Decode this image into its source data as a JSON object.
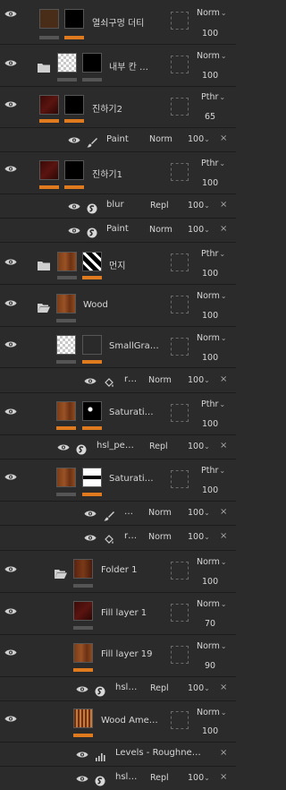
{
  "layers": [
    {
      "id": "l1",
      "name": "열쇠구멍 더티",
      "blend": "Norm",
      "opacity": "100"
    },
    {
      "id": "l2",
      "name": "내부 칸 …",
      "blend": "Norm",
      "opacity": "100"
    },
    {
      "id": "l3",
      "name": "진하기2",
      "blend": "Pthr",
      "opacity": "65"
    },
    {
      "id": "l3a",
      "name": "Paint",
      "blend": "Norm",
      "opacity": "100"
    },
    {
      "id": "l4",
      "name": "진하기1",
      "blend": "Pthr",
      "opacity": "100"
    },
    {
      "id": "l4a",
      "name": "blur",
      "blend": "Repl",
      "opacity": "100"
    },
    {
      "id": "l4b",
      "name": "Paint",
      "blend": "Norm",
      "opacity": "100"
    },
    {
      "id": "l5",
      "name": "먼지",
      "blend": "Pthr",
      "opacity": "100"
    },
    {
      "id": "l6",
      "name": "Wood",
      "blend": "Norm",
      "opacity": "100"
    },
    {
      "id": "l7",
      "name": "SmallGra…",
      "blend": "Norm",
      "opacity": "100"
    },
    {
      "id": "l7a",
      "name": "r…",
      "blend": "Norm",
      "opacity": "100"
    },
    {
      "id": "l8",
      "name": "Saturati…",
      "blend": "Pthr",
      "opacity": "100"
    },
    {
      "id": "l8a",
      "name": "hsl_pe…",
      "blend": "Repl",
      "opacity": "100"
    },
    {
      "id": "l9",
      "name": "Saturati…",
      "blend": "Pthr",
      "opacity": "100"
    },
    {
      "id": "l9a",
      "name": "…",
      "blend": "Norm",
      "opacity": "100"
    },
    {
      "id": "l9b",
      "name": "r…",
      "blend": "Norm",
      "opacity": "100"
    },
    {
      "id": "l10",
      "name": "Folder 1",
      "blend": "Norm",
      "opacity": "100"
    },
    {
      "id": "l11",
      "name": "Fill layer 1",
      "blend": "Norm",
      "opacity": "70"
    },
    {
      "id": "l12",
      "name": "Fill layer 19",
      "blend": "Norm",
      "opacity": "90"
    },
    {
      "id": "l12a",
      "name": "hsl…",
      "blend": "Repl",
      "opacity": "100"
    },
    {
      "id": "l13",
      "name": "Wood Ame…",
      "blend": "Norm",
      "opacity": "100"
    },
    {
      "id": "l13a",
      "name": "Levels - Roughne…",
      "blend": "",
      "opacity": ""
    },
    {
      "id": "l13b",
      "name": "hsl…",
      "blend": "Repl",
      "opacity": "100"
    }
  ],
  "colors": {
    "accent": "#e07a1f",
    "bg": "#2b2b2b"
  }
}
